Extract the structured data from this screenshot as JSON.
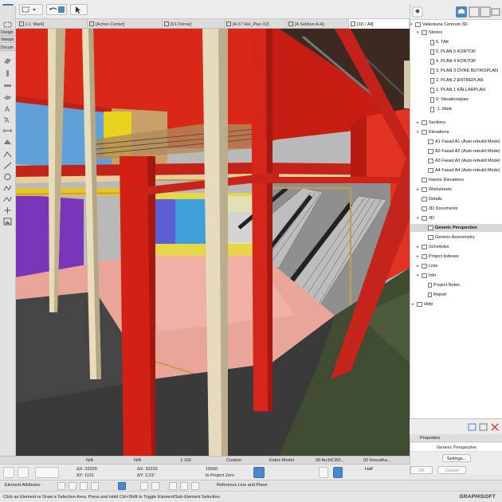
{
  "tabs": [
    {
      "label": "[-1. Mark]"
    },
    {
      "label": "[Action Center]"
    },
    {
      "label": "[01 Dörrar]"
    },
    {
      "label": "[A 07 Rel_Plan 02]"
    },
    {
      "label": "[A Sektion A-A]"
    },
    {
      "label": "[3D / All]"
    }
  ],
  "toolbox": {
    "tabs": [
      "Design",
      "Viewpo",
      "Docum"
    ]
  },
  "navigator": {
    "project": "Vallentuna Centrum 3D",
    "stories_label": "Stories",
    "stories": [
      "6. TAK",
      "5. PLAN 5 KONTOR",
      "4. PLAN 4 KONTOR",
      "3. PLAN 3 ÖVRE BUTIKSPLAN",
      "2. PLAN 2 ENTRÉPLAN",
      "1. PLAN 1 KÄLLARPLAN",
      "0. Situationsplan",
      "-1. Mark"
    ],
    "sections_label": "Sections",
    "elevations_label": "Elevations",
    "elevations": [
      "A1 Fasad A1 (Auto-rebuild Mode)",
      "A2 Fasad A2 (Auto-rebuild Mode)",
      "A3 Fasad A3 (Auto-rebuild Mode)",
      "A4 Fasad A4 (Auto-rebuild Mode)"
    ],
    "interior_label": "Interior Elevations",
    "worksheets_label": "Worksheets",
    "details_label": "Details",
    "documents3d_label": "3D Documents",
    "view3d_label": "3D",
    "view3d_items": [
      "Generic Perspective",
      "Generic Axonometry"
    ],
    "schedules_label": "Schedules",
    "indexes_label": "Project Indexes",
    "lists_label": "Lists",
    "info_label": "Info",
    "info_items": [
      "Project Notes",
      "Report"
    ],
    "help_label": "Help"
  },
  "properties": {
    "header": "Properties",
    "value": "Generic Perspective",
    "settings": "Settings...",
    "ok": "OK",
    "cancel": "Cancel"
  },
  "quick_options": {
    "na1": "N/A",
    "na2": "N/A",
    "scale": "1:100",
    "pen": "Custom",
    "model": "Entire Model",
    "archicad": "00 ArchiCAD...",
    "huvud": "02 Huvudha..."
  },
  "infobox": {
    "element_attributes": "Element Attributes",
    "dx1": "ΔX: 32200",
    "dy1": "ΔY: 1131",
    "dx2": "ΔX: 32220",
    "dy2": "ΔY: 2,01°",
    "z_value": "15500",
    "z_ref": "to Project Zero",
    "half": "Half",
    "ref_line": "Reference Line and Plane"
  },
  "status": {
    "message": "Click an Element or Draw a Selection Area. Press and Hold Ctrl+Shift to Toggle Element/Sub-Element Selection.",
    "brand": "GRAPHISOFT"
  },
  "colors": {
    "accent": "#4a88c7",
    "selection": "#d7d7d7"
  }
}
